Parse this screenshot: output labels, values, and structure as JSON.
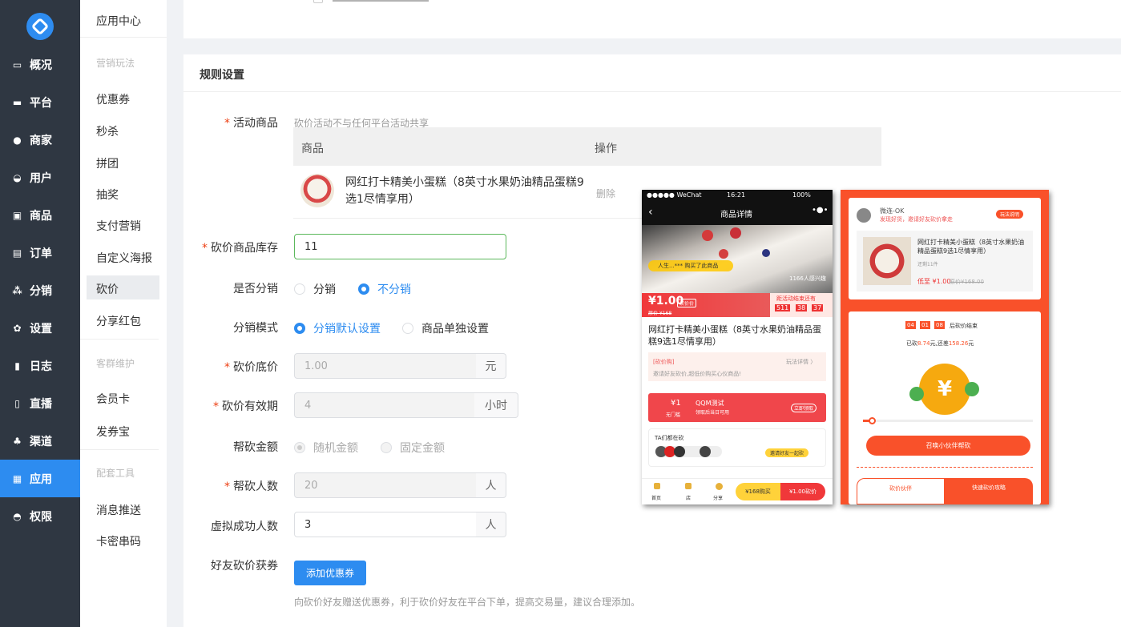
{
  "nav": [
    {
      "label": "概况",
      "icon": "monitor-icon"
    },
    {
      "label": "平台",
      "icon": "desktop-icon"
    },
    {
      "label": "商家",
      "icon": "store-icon"
    },
    {
      "label": "用户",
      "icon": "user-icon"
    },
    {
      "label": "商品",
      "icon": "goods-icon"
    },
    {
      "label": "订单",
      "icon": "order-icon"
    },
    {
      "label": "分销",
      "icon": "tree-icon"
    },
    {
      "label": "设置",
      "icon": "gear-icon"
    },
    {
      "label": "日志",
      "icon": "log-icon"
    },
    {
      "label": "直播",
      "icon": "live-icon"
    },
    {
      "label": "渠道",
      "icon": "channel-icon"
    },
    {
      "label": "应用",
      "icon": "apps-icon",
      "active": true
    },
    {
      "label": "权限",
      "icon": "lock-icon"
    }
  ],
  "sub": {
    "app_center": "应用中心",
    "cat_marketing": "营销玩法",
    "marketing": [
      "优惠券",
      "秒杀",
      "拼团",
      "抽奖",
      "支付营销",
      "自定义海报",
      "砍价",
      "分享红包"
    ],
    "cat_customer": "客群维护",
    "customer": [
      "会员卡",
      "发券宝"
    ],
    "cat_tools": "配套工具",
    "tools": [
      "消息推送",
      "卡密串码"
    ]
  },
  "form": {
    "section_title": "规则设置",
    "product_label": "活动商品",
    "product_hint": "砍价活动不与任何平台活动共享",
    "table_head_product": "商品",
    "table_head_action": "操作",
    "product_name": "网红打卡精美小蛋糕（8英寸水果奶油精品蛋糕9选1尽情享用）",
    "delete_label": "删除",
    "stock_label": "砍价商品库存",
    "stock_value": "11",
    "distrib_label": "是否分销",
    "distrib_yes": "分销",
    "distrib_no": "不分销",
    "mode_label": "分销模式",
    "mode_default": "分销默认设置",
    "mode_single": "商品单独设置",
    "floor_label": "砍价底价",
    "floor_value": "1.00",
    "floor_unit": "元",
    "valid_label": "砍价有效期",
    "valid_value": "4",
    "valid_unit": "小时",
    "amount_label": "帮砍金额",
    "amount_random": "随机金额",
    "amount_fixed": "固定金额",
    "helpers_label": "帮砍人数",
    "helpers_value": "20",
    "helpers_unit": "人",
    "virtual_label": "虚拟成功人数",
    "virtual_value": "3",
    "virtual_unit": "人",
    "gift_label": "好友砍价获券",
    "gift_button": "添加优惠券",
    "gift_hint": "向砍价好友赠送优惠券，利于砍价好友在平台下单，提高交易量，建议合理添加。"
  },
  "phone1": {
    "carrier": "●●●●● WeChat",
    "time": "16:21",
    "battery": "100%",
    "title": "商品详情",
    "buyer": "人生...*** 购买了此商品",
    "interested": "1166人感兴趣",
    "price": "¥1.00",
    "price_tag": "砍价价",
    "orig": "原价 ¥168",
    "countdown_label": "距活动结束还有",
    "cd_h": "511",
    "cd_m": "38",
    "cd_s": "37",
    "product_name": "网红打卡精美小蛋糕（8英寸水果奶油精品蛋糕9选1尽情享用）",
    "rule_title": "[砍价购]",
    "rule_detail": "玩法详情 〉",
    "rule_text": "邀请好友砍价,超低价购买心仪商品!",
    "coupon_amount": "¥1",
    "coupon_cond": "无门槛",
    "coupon_name": "QQM测试",
    "coupon_desc": "领取后当日可用",
    "coupon_btn": "立即领取",
    "bargaining": "TA们都在砍",
    "invite_btn": "邀请好友一起砍",
    "tab_home": "首页",
    "tab_shop": "店",
    "tab_share": "分享",
    "buy_btn": "¥168购买",
    "bargain_btn": "¥1.00砍价"
  },
  "phone2": {
    "user": "微连-OK",
    "invite": "发现好货，邀请好友砍价拿走",
    "rules_btn": "玩法说明",
    "product_name": "网红打卡精美小蛋糕（8英寸水果奶油精品蛋糕9选1尽情享用）",
    "stock": "还剩11件",
    "low_price": "低至 ¥1.00",
    "orig": "原价¥168.00",
    "cd_h": "04",
    "cd_m": "01",
    "cd_s": "08",
    "cd_label": "后砍价结束",
    "progress_text_a": "已砍",
    "progress_done": "8.74",
    "progress_text_b": "元,还差",
    "progress_left": "158.26",
    "progress_text_c": "元",
    "progress_fraction": 0.05,
    "call_btn": "召唤小伙伴帮砍",
    "tab_partners": "砍价伙伴",
    "tab_guide": "快速砍价攻略"
  }
}
